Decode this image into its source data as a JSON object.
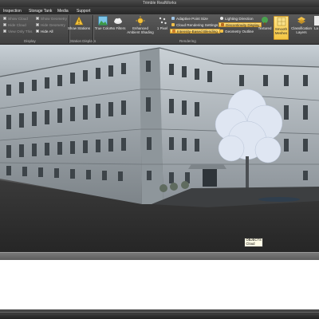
{
  "app": {
    "title": "Trimble RealWorks"
  },
  "menu": [
    "Inspection",
    "Storage Tank",
    "Media",
    "Support"
  ],
  "display_group": {
    "label": "Display",
    "col1": [
      "Show Cloud",
      "Hide Cloud",
      "View Only This"
    ],
    "col2": [
      "Show Geometry",
      "Hide Geometry",
      "Hide All"
    ]
  },
  "stations_group": {
    "label": "Station Displays",
    "show_stations": "Show Stations"
  },
  "rendering_group": {
    "label": "Rendering",
    "true_color": "True Color",
    "no_filters": "No Filters",
    "enhanced_ambient": "Enhanced Ambient Shading",
    "point_size": "1 Pixel",
    "opt_col1": [
      "Adaptive Point Size",
      "Cloud Rendering Settings",
      "Intensity-Based Blending"
    ],
    "opt_col2": [
      "Lighting Direction",
      "Discontinuity Display",
      "Geometry Outline"
    ],
    "textured": "Textured",
    "smooth_meshes": "Smooth Meshes",
    "classification_layers": "Classification Layers",
    "extra": "La"
  },
  "viewport": {
    "tooltip": [
      "OBJECTS",
      "Cloud"
    ]
  },
  "colors": {
    "ribbon": "#4a4a4a",
    "highlight": "#f4c542",
    "building_wall": "#a9b2b8",
    "tree": "#dfe6f2"
  },
  "icons": {
    "stations": "warning-triangle-icon",
    "true_color": "landscape-icon",
    "no_filters": "cloud-icon",
    "enhanced_ambient": "sun-icon",
    "point_size": "dots-icon",
    "textured": "tree-icon",
    "smooth_meshes": "mesh-icon",
    "classification_layers": "layers-icon"
  }
}
